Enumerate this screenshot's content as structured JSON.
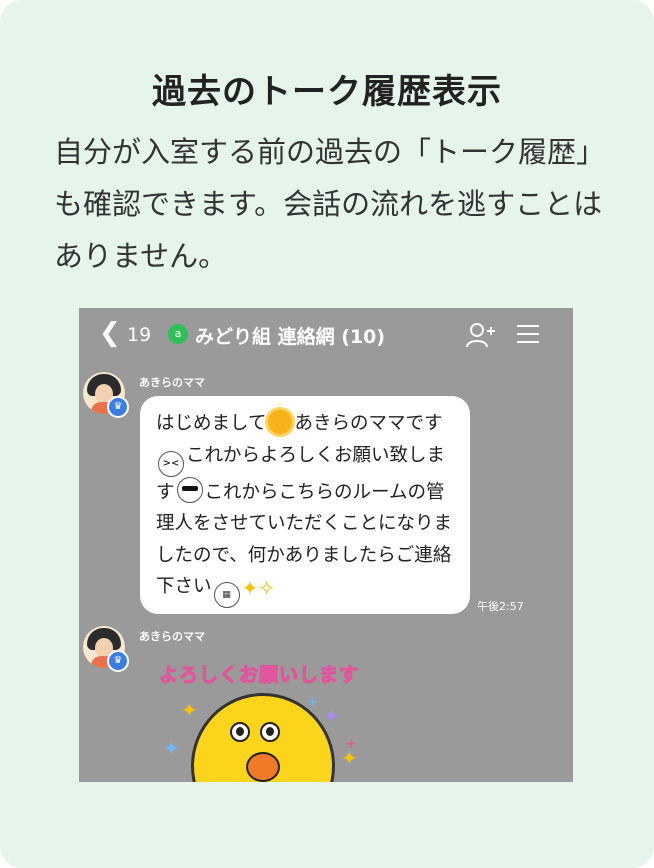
{
  "page": {
    "title": "過去のトーク履歴表示",
    "description": "自分が入室する前の過去の「トーク履歴」も確認できます。会話の流れを逃すことはありません。"
  },
  "chat": {
    "header": {
      "back_count": "19",
      "group_icon_letter": "a",
      "group_name": "みどり組 連絡網 (10)"
    },
    "messages": [
      {
        "sender": "あきらのママ",
        "segments": [
          "はじめまして",
          "あきらのママです",
          "これからよろしくお願い致します",
          "これからこちらのルームの管理人をさせていただくことになりましたので、何かありましたらご連絡下さい"
        ],
        "time": "午後2:57"
      },
      {
        "sender": "あきらのママ",
        "sticker_text": "よろしくお願いします"
      }
    ]
  },
  "icons": [
    "chevron-left-icon",
    "group-icon",
    "add-user-icon",
    "menu-icon",
    "crown-icon",
    "sun-emoji",
    "laugh-emoji",
    "sunglasses-emoji",
    "grin-emoji",
    "sparkle-emoji"
  ],
  "colors": {
    "card_bg": "#e6f5ea",
    "chat_bg": "#9a9a9a",
    "accent_green": "#2fbf5a",
    "admin_badge": "#3b7de0"
  }
}
